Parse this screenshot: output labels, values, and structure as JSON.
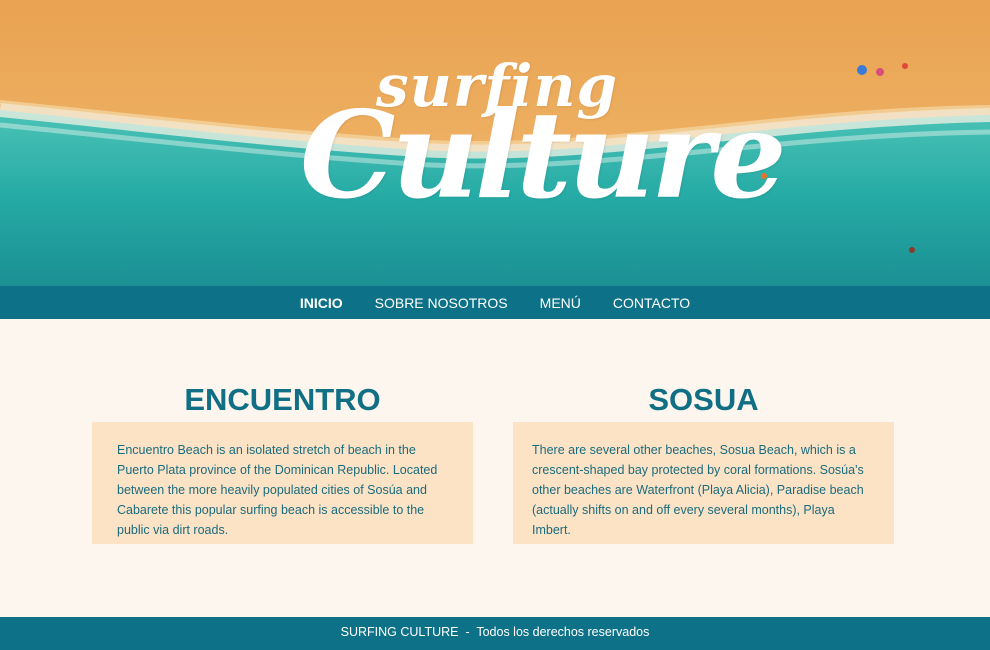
{
  "hero": {
    "logo_line1": "surfing",
    "logo_line2": "Culture"
  },
  "nav": {
    "items": [
      {
        "label": "INICIO",
        "active": true
      },
      {
        "label": "SOBRE NOSOTROS",
        "active": false
      },
      {
        "label": "MENÚ",
        "active": false
      },
      {
        "label": "CONTACTO",
        "active": false
      }
    ]
  },
  "sections": [
    {
      "title": "ENCUENTRO",
      "text": "Encuentro Beach is an isolated stretch of beach in the Puerto Plata province of the Dominican Republic. Located between the more heavily populated cities of Sosúa and Cabarete this popular surfing beach is accessible to the public via dirt roads."
    },
    {
      "title": "SOSUA",
      "text": "There are several other beaches, Sosua Beach, which is a crescent-shaped bay protected by coral formations. Sosúa's other beaches are Waterfront (Playa Alicia), Paradise beach (actually shifts on and off every several months), Playa Imbert."
    }
  ],
  "footer": {
    "brand": "SURFING CULTURE",
    "separator": "-",
    "rights": "Todos los derechos reservados"
  },
  "colors": {
    "accent": "#0d7287",
    "heading": "#106f84",
    "card_bg": "#fde3c6",
    "page_bg": "#fdf6ee"
  }
}
